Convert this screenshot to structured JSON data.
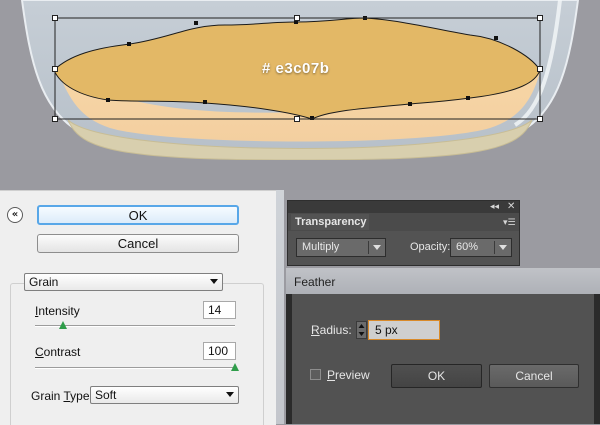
{
  "canvas": {
    "color_label": "# e3c07b",
    "sand_color": "#e3c07b"
  },
  "filter_panel": {
    "collapse_icon": "double-chevron-up-icon",
    "ok_label": "OK",
    "cancel_label": "Cancel",
    "filter_selected": "Grain",
    "intensity": {
      "label_initial": "I",
      "label_rest": "ntensity",
      "value": "14",
      "slider_fraction": 0.14
    },
    "contrast": {
      "label_initial": "C",
      "label_rest": "ontrast",
      "value": "100",
      "slider_fraction": 1.0
    },
    "grain_type": {
      "label_before": "Grain ",
      "label_accel": "T",
      "label_after": "ype:",
      "selected": "Soft"
    }
  },
  "transparency_panel": {
    "tab_label": "Transparency",
    "blend_mode": "Multiply",
    "opacity_label": "Opacity:",
    "opacity_value": "60%",
    "icons": [
      "collapse-arrows-icon",
      "close-icon",
      "panel-menu-icon"
    ]
  },
  "feather_dialog": {
    "title": "Feather",
    "radius_label_initial": "R",
    "radius_label_rest": "adius:",
    "radius_value": "5 px",
    "preview_label_initial": "P",
    "preview_label_rest": "review",
    "preview_checked": false,
    "ok_label": "OK",
    "cancel_label": "Cancel"
  }
}
